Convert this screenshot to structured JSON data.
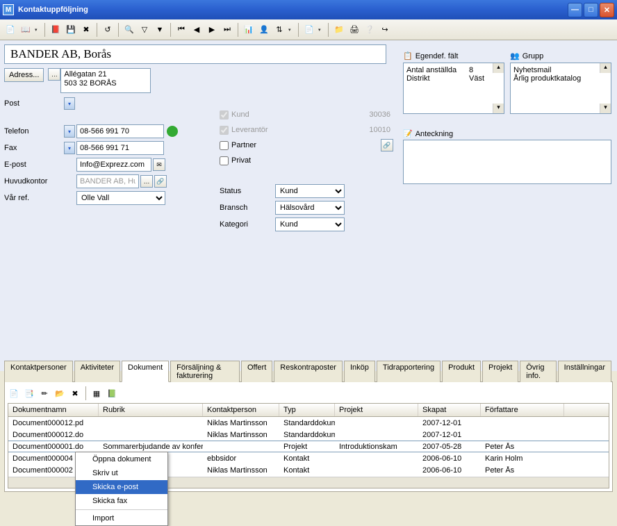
{
  "window": {
    "title": "Kontaktuppföljning"
  },
  "company": {
    "name": "BANDER AB, Borås"
  },
  "address": {
    "button": "Adress...",
    "line1": "Allégatan 21",
    "line2": "503 32 BORÅS"
  },
  "labels": {
    "post": "Post",
    "telefon": "Telefon",
    "fax": "Fax",
    "epost": "E-post",
    "huvudkontor": "Huvudkontor",
    "varref": "Vår ref.",
    "status": "Status",
    "bransch": "Bransch",
    "kategori": "Kategori"
  },
  "fields": {
    "telefon": "08-566 991 70",
    "fax": "08-566 991 71",
    "epost": "Info@Exprezz.com",
    "huvudkontor": "BANDER AB, Huvudk",
    "varref": "Olle Vall",
    "status": "Kund",
    "bransch": "Hälsovård",
    "kategori": "Kund"
  },
  "checks": {
    "kund": "Kund",
    "kund_num": "30036",
    "lev": "Leverantör",
    "lev_num": "10010",
    "partner": "Partner",
    "privat": "Privat"
  },
  "egendef": {
    "title": "Egendef. fält",
    "rows": [
      {
        "name": "Antal anställda",
        "val": "8"
      },
      {
        "name": "Distrikt",
        "val": "Väst"
      }
    ]
  },
  "grupp": {
    "title": "Grupp",
    "items": [
      "Nyhetsmail",
      "Årlig produktkatalog"
    ]
  },
  "anteckning": {
    "title": "Anteckning"
  },
  "tabs": [
    "Kontaktpersoner",
    "Aktiviteter",
    "Dokument",
    "Försäljning & fakturering",
    "Offert",
    "Reskontraposter",
    "Inköp",
    "Tidrapportering",
    "Produkt",
    "Projekt",
    "Övrig info.",
    "Inställningar"
  ],
  "grid": {
    "headers": [
      "Dokumentnamn",
      "Rubrik",
      "Kontaktperson",
      "Typ",
      "Projekt",
      "Skapat",
      "Författare"
    ],
    "rows": [
      {
        "c1": "Document000012.pd",
        "c2": "",
        "c3": "Niklas Martinsson",
        "c4": "Standarddokum",
        "c5": "",
        "c6": "2007-12-01",
        "c7": ""
      },
      {
        "c1": "Document000012.do",
        "c2": "",
        "c3": "Niklas Martinsson",
        "c4": "Standarddokum",
        "c5": "",
        "c6": "2007-12-01",
        "c7": ""
      },
      {
        "c1": "Document000001.do",
        "c2": "Sommarerbjudande av konfere",
        "c3": "",
        "c4": "Projekt",
        "c5": "Introduktionskam",
        "c6": "2007-05-28",
        "c7": "Peter Ås"
      },
      {
        "c1": "Document000004",
        "c2": "",
        "c3": "ebbsidor",
        "c4": "Kontakt",
        "c5": "",
        "c6": "2006-06-10",
        "c7": "Karin Holm"
      },
      {
        "c1": "Document000002",
        "c2": "",
        "c3": "Niklas Martinsson",
        "c4": "Kontakt",
        "c5": "",
        "c6": "2006-06-10",
        "c7": "Peter Ås"
      }
    ]
  },
  "context_menu": {
    "items": [
      "Öppna dokument",
      "Skriv ut",
      "Skicka e-post",
      "Skicka fax",
      "Import"
    ]
  }
}
